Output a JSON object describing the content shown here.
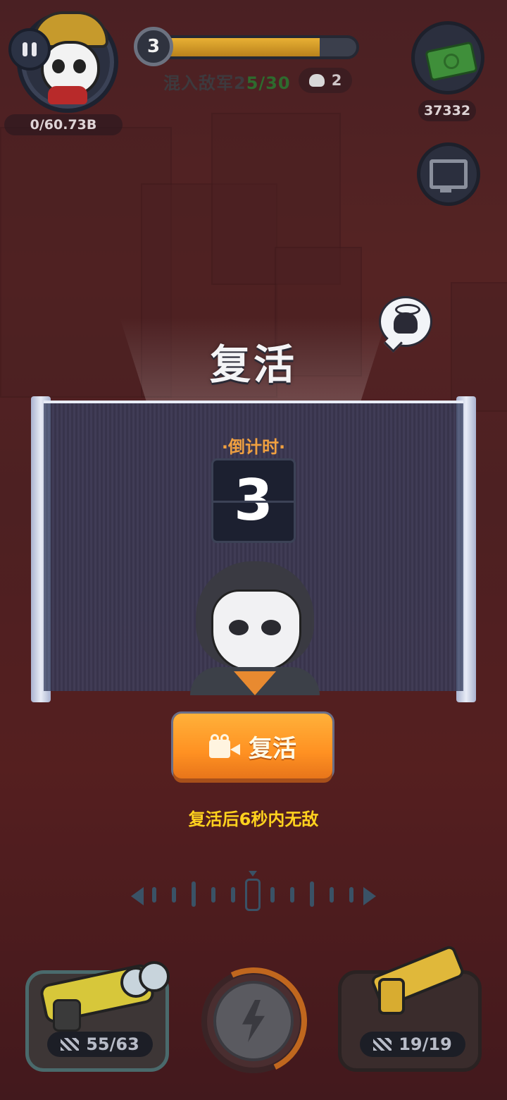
{
  "hud": {
    "score_text": "0/60.73B",
    "level": "3",
    "level_progress": 0.82,
    "mission_prefix": "混入敌军2",
    "mission_current": "5/30",
    "kill_count": "2",
    "coins": "37332"
  },
  "dialog": {
    "title": "复活",
    "countdown_label": "·倒计时·",
    "countdown_value": "3",
    "revive_button_label": "复活",
    "invincible_text": "复活后6秒内无敌"
  },
  "weapons": {
    "primary_ammo": "55/63",
    "secondary_ammo": "19/19"
  },
  "colors": {
    "accent_orange": "#ff9122",
    "countdown_orange": "#f0a040",
    "invincible_yellow": "#ffd21e"
  },
  "icons": [
    "pause-icon",
    "cash-icon",
    "monitor-icon",
    "skull-icon",
    "camera-icon",
    "lightning-icon",
    "bullets-icon"
  ]
}
